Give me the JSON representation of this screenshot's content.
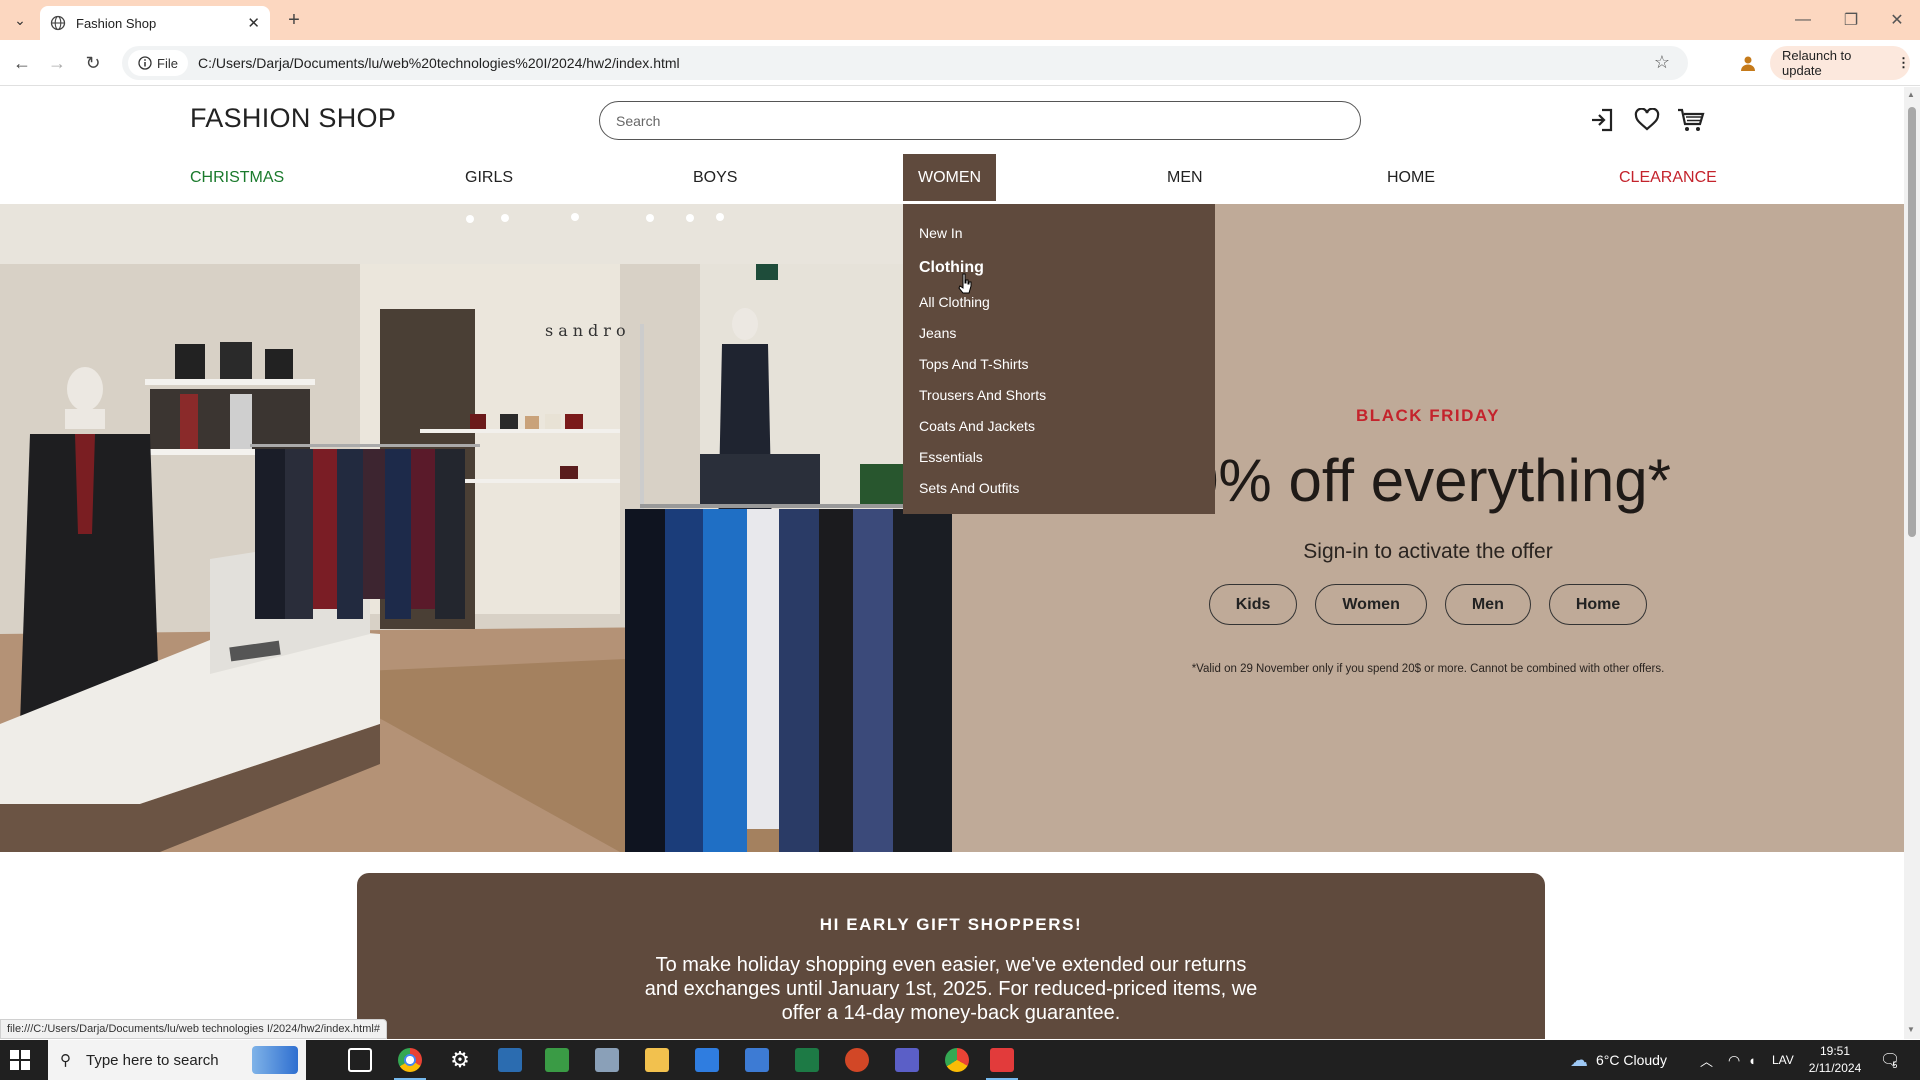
{
  "browser": {
    "tab_title": "Fashion Shop",
    "file_chip": "File",
    "url": "C:/Users/Darja/Documents/lu/web%20technologies%20I/2024/hw2/index.html",
    "relaunch_label": "Relaunch to update",
    "status_url": "file:///C:/Users/Darja/Documents/lu/web technologies I/2024/hw2/index.html#"
  },
  "site": {
    "logo": "FASHION SHOP",
    "search_placeholder": "Search"
  },
  "nav": [
    {
      "label": "CHRISTMAS",
      "color": "#1a7a2c"
    },
    {
      "label": "GIRLS",
      "color": "#222222"
    },
    {
      "label": "BOYS",
      "color": "#222222"
    },
    {
      "label": "WOMEN",
      "color": "#ffffff"
    },
    {
      "label": "MEN",
      "color": "#222222"
    },
    {
      "label": "HOME",
      "color": "#222222"
    },
    {
      "label": "CLEARANCE",
      "color": "#c4232c"
    }
  ],
  "dropdown": {
    "new_in": "New In",
    "heading": "Clothing",
    "items": [
      "All Clothing",
      "Jeans",
      "Tops And T-Shirts",
      "Trousers And Shorts",
      "Coats And Jackets",
      "Essentials",
      "Sets And Outfits"
    ]
  },
  "hero": {
    "kicker": "BLACK FRIDAY",
    "headline": "0% off everything*",
    "signin": "Sign-in to activate the offer",
    "buttons": [
      "Kids",
      "Women",
      "Men",
      "Home"
    ],
    "fine_print": "*Valid on 29 November only if you spend 20$ or more. Cannot be combined with other offers.",
    "photo_sign": "sandro"
  },
  "gift": {
    "heading": "HI EARLY GIFT SHOPPERS!",
    "body": "To make holiday shopping even easier, we've extended our returns and exchanges until January 1st, 2025. For reduced-priced items, we offer a 14-day money-back guarantee."
  },
  "taskbar": {
    "search_placeholder": "Type here to search",
    "weather": "6°C  Cloudy",
    "lang": "LAV",
    "time": "19:51",
    "date": "2/11/2024",
    "notifications": "5"
  },
  "colors": {
    "tabbar": "#fcd7c0",
    "brown": "#5f4a3d",
    "hero_bg": "#bfaa98",
    "accent_red": "#c4232c",
    "christmas_green": "#1a7a2c"
  }
}
